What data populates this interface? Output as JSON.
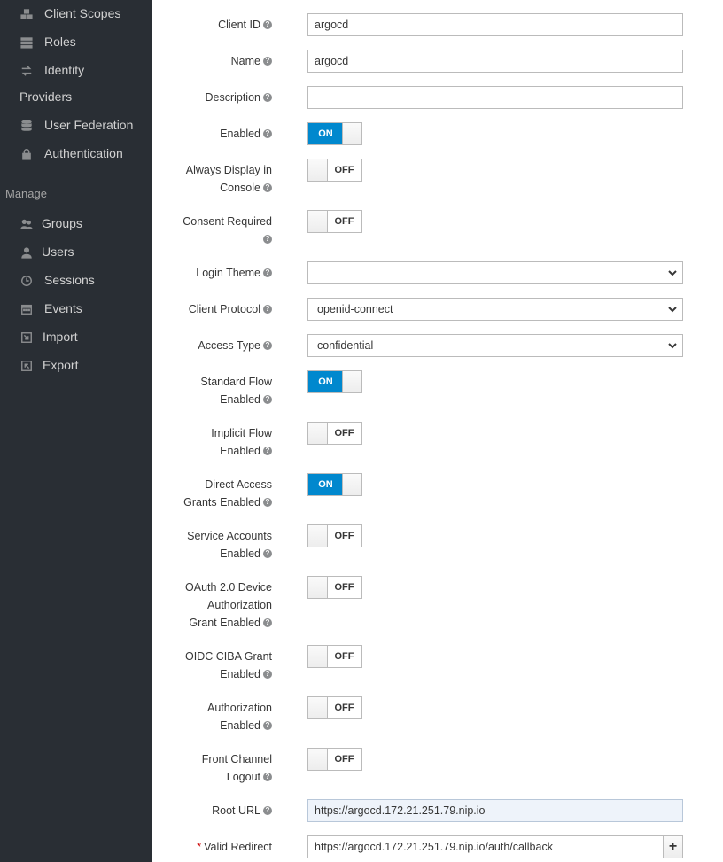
{
  "sidebar": {
    "items_top": [
      {
        "label": "Client Scopes",
        "icon": "client-scopes-icon"
      },
      {
        "label": "Roles",
        "icon": "roles-icon"
      },
      {
        "label": "Identity",
        "label2": "Providers",
        "icon": "identity-providers-icon"
      },
      {
        "label": "User Federation",
        "icon": "database-icon"
      },
      {
        "label": "Authentication",
        "icon": "lock-icon"
      }
    ],
    "section_manage": "Manage",
    "items_manage": [
      {
        "label": "Groups",
        "icon": "groups-icon"
      },
      {
        "label": "Users",
        "icon": "user-icon"
      },
      {
        "label": "Sessions",
        "icon": "clock-icon"
      },
      {
        "label": "Events",
        "icon": "calendar-icon"
      },
      {
        "label": "Import",
        "icon": "import-icon"
      },
      {
        "label": "Export",
        "icon": "export-icon"
      }
    ]
  },
  "form": {
    "client_id": {
      "label": "Client ID",
      "value": "argocd"
    },
    "name": {
      "label": "Name",
      "value": "argocd"
    },
    "description": {
      "label": "Description",
      "value": ""
    },
    "enabled": {
      "label": "Enabled",
      "state": "ON"
    },
    "always_display": {
      "label1": "Always Display in",
      "label2": "Console",
      "state": "OFF"
    },
    "consent_required": {
      "label1": "Consent Required",
      "state": "OFF"
    },
    "login_theme": {
      "label": "Login Theme",
      "value": ""
    },
    "client_protocol": {
      "label": "Client Protocol",
      "value": "openid-connect"
    },
    "access_type": {
      "label": "Access Type",
      "value": "confidential"
    },
    "standard_flow": {
      "label1": "Standard Flow",
      "label2": "Enabled",
      "state": "ON"
    },
    "implicit_flow": {
      "label1": "Implicit Flow",
      "label2": "Enabled",
      "state": "OFF"
    },
    "direct_access": {
      "label1": "Direct Access",
      "label2": "Grants Enabled",
      "state": "ON"
    },
    "service_accounts": {
      "label1": "Service Accounts",
      "label2": "Enabled",
      "state": "OFF"
    },
    "device_auth": {
      "label1": "OAuth 2.0 Device",
      "label2": "Authorization",
      "label3": "Grant Enabled",
      "state": "OFF"
    },
    "ciba": {
      "label1": "OIDC CIBA Grant",
      "label2": "Enabled",
      "state": "OFF"
    },
    "authorization": {
      "label1": "Authorization",
      "label2": "Enabled",
      "state": "OFF"
    },
    "front_channel": {
      "label1": "Front Channel",
      "label2": "Logout",
      "state": "OFF"
    },
    "root_url": {
      "label": "Root URL",
      "value": "https://argocd.172.21.251.79.nip.io"
    },
    "valid_redirect": {
      "required_mark": "*",
      "label": "Valid Redirect",
      "value": "https://argocd.172.21.251.79.nip.io/auth/callback",
      "add_label": "+"
    }
  },
  "colors": {
    "sidebar_bg": "#292e34",
    "toggle_on": "#0088ce"
  }
}
